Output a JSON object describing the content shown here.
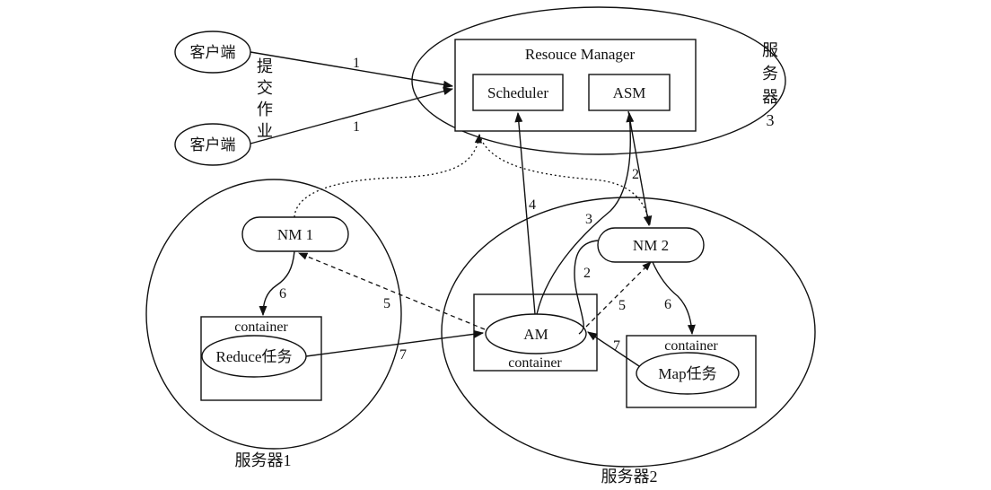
{
  "nodes": {
    "client_1": "客户端",
    "client_2": "客户端",
    "submit_job": [
      "提",
      "交",
      "作",
      "业"
    ],
    "resource_manager": "Resouce Manager",
    "scheduler": "Scheduler",
    "asm": "ASM",
    "server3": [
      "服",
      "务",
      "器",
      "3"
    ],
    "nm1": "NM 1",
    "nm2": "NM 2",
    "container_left": "container",
    "reduce_task": "Reduce任务",
    "am": "AM",
    "am_container": "container",
    "container_right": "container",
    "map_task": "Map任务",
    "server1": "服务器1",
    "server2": "服务器2"
  },
  "steps": {
    "s1a": "1",
    "s1b": "1",
    "s2a": "2",
    "s2b": "2",
    "s3": "3",
    "s4": "4",
    "s5a": "5",
    "s5b": "5",
    "s6a": "6",
    "s6b": "6",
    "s7a": "7",
    "s7b": "7"
  }
}
